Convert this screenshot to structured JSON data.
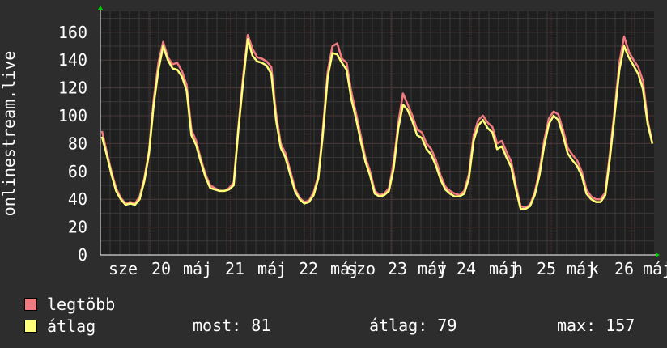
{
  "chart_data": {
    "type": "line",
    "ylabel": "onlinestream.live",
    "ylim": [
      0,
      175
    ],
    "yticks": [
      0,
      20,
      40,
      60,
      80,
      100,
      120,
      140,
      160
    ],
    "grid": true,
    "xtick_labels": [
      "sze",
      "20",
      "máj",
      "21",
      "máj",
      "22",
      "máj",
      "szo",
      "23",
      "máj",
      "v",
      "24",
      "máj",
      "h",
      "25",
      "máj",
      "k",
      "26",
      "máj"
    ],
    "series": [
      {
        "name": "legtöbb",
        "color": "#f07a7f",
        "values": [
          89,
          74,
          60,
          48,
          41,
          37,
          38,
          37,
          42,
          55,
          75,
          112,
          138,
          153,
          142,
          137,
          138,
          132,
          122,
          90,
          82,
          69,
          58,
          50,
          48,
          46,
          46,
          48,
          52,
          92,
          128,
          158,
          148,
          142,
          141,
          139,
          135,
          102,
          80,
          73,
          61,
          48,
          41,
          38,
          39,
          45,
          57,
          92,
          132,
          150,
          152,
          141,
          138,
          117,
          102,
          86,
          70,
          60,
          46,
          43,
          44,
          48,
          66,
          95,
          116,
          108,
          100,
          90,
          88,
          80,
          76,
          68,
          57,
          49,
          46,
          44,
          43,
          46,
          58,
          86,
          97,
          100,
          95,
          92,
          80,
          82,
          74,
          67,
          50,
          35,
          34,
          36,
          45,
          60,
          82,
          98,
          103,
          101,
          90,
          77,
          72,
          68,
          60,
          47,
          42,
          40,
          40,
          45,
          74,
          105,
          138,
          157,
          146,
          140,
          135,
          125,
          97,
          80
        ]
      },
      {
        "name": "átlag",
        "color": "#ffff7a",
        "values": [
          85,
          72,
          58,
          46,
          40,
          36,
          37,
          36,
          40,
          53,
          73,
          108,
          133,
          150,
          140,
          134,
          133,
          128,
          118,
          86,
          79,
          67,
          56,
          48,
          47,
          46,
          46,
          47,
          50,
          90,
          124,
          155,
          143,
          139,
          138,
          136,
          130,
          97,
          77,
          70,
          58,
          46,
          40,
          37,
          38,
          43,
          55,
          88,
          128,
          145,
          144,
          138,
          133,
          112,
          98,
          82,
          67,
          57,
          44,
          42,
          43,
          46,
          62,
          91,
          108,
          104,
          96,
          86,
          84,
          76,
          72,
          64,
          54,
          47,
          44,
          42,
          42,
          44,
          55,
          82,
          93,
          97,
          91,
          88,
          76,
          78,
          70,
          63,
          47,
          33,
          33,
          35,
          43,
          57,
          78,
          94,
          100,
          97,
          86,
          73,
          68,
          64,
          57,
          44,
          40,
          38,
          38,
          43,
          70,
          101,
          133,
          150,
          142,
          136,
          130,
          119,
          94,
          80
        ]
      }
    ]
  },
  "legend": {
    "max_label": "legtöbb",
    "avg_label": "átlag",
    "max_color": "#f07a7f",
    "avg_color": "#ffff7a"
  },
  "stats": {
    "current": "most: 81",
    "average": "átlag: 79",
    "maximum": "max: 157"
  }
}
